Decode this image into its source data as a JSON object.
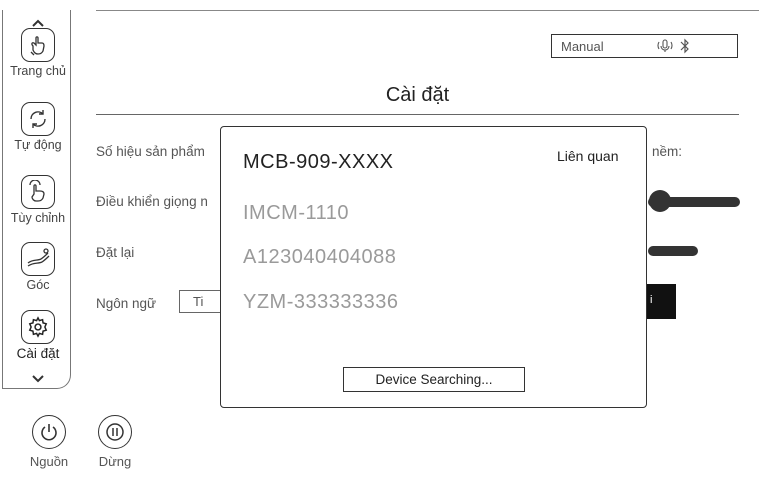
{
  "sidebar": {
    "items": [
      {
        "label": "Trang chủ",
        "icon": "hand-icon"
      },
      {
        "label": "Tự động",
        "icon": "sync-icon"
      },
      {
        "label": "Tùy chỉnh",
        "icon": "hand-point-icon"
      },
      {
        "label": "Góc",
        "icon": "recline-icon"
      },
      {
        "label": "Cài đặt",
        "icon": "gear-icon"
      }
    ]
  },
  "header": {
    "mode": "Manual"
  },
  "page": {
    "title": "Cài đặt",
    "rows": {
      "product_number": "Số hiệu sản phẩm",
      "voice_control": "Điều khiển giọng n",
      "reset": "Đặt lại",
      "language": "Ngôn ngữ",
      "language_value": "Ti",
      "software_suffix": "nềm:",
      "button_fragment": "i"
    }
  },
  "bottom": {
    "power_label": "Nguồn",
    "pause_label": "Dừng"
  },
  "modal": {
    "selected": "MCB-909-XXXX",
    "related_label": "Liên quan",
    "items": [
      "IMCM-1110",
      "A123040404088",
      "YZM-333333336"
    ],
    "search_button": "Device Searching..."
  },
  "colors": {
    "text_dark": "#222222",
    "text_muted": "#9a9a9a",
    "line": "#777777"
  }
}
